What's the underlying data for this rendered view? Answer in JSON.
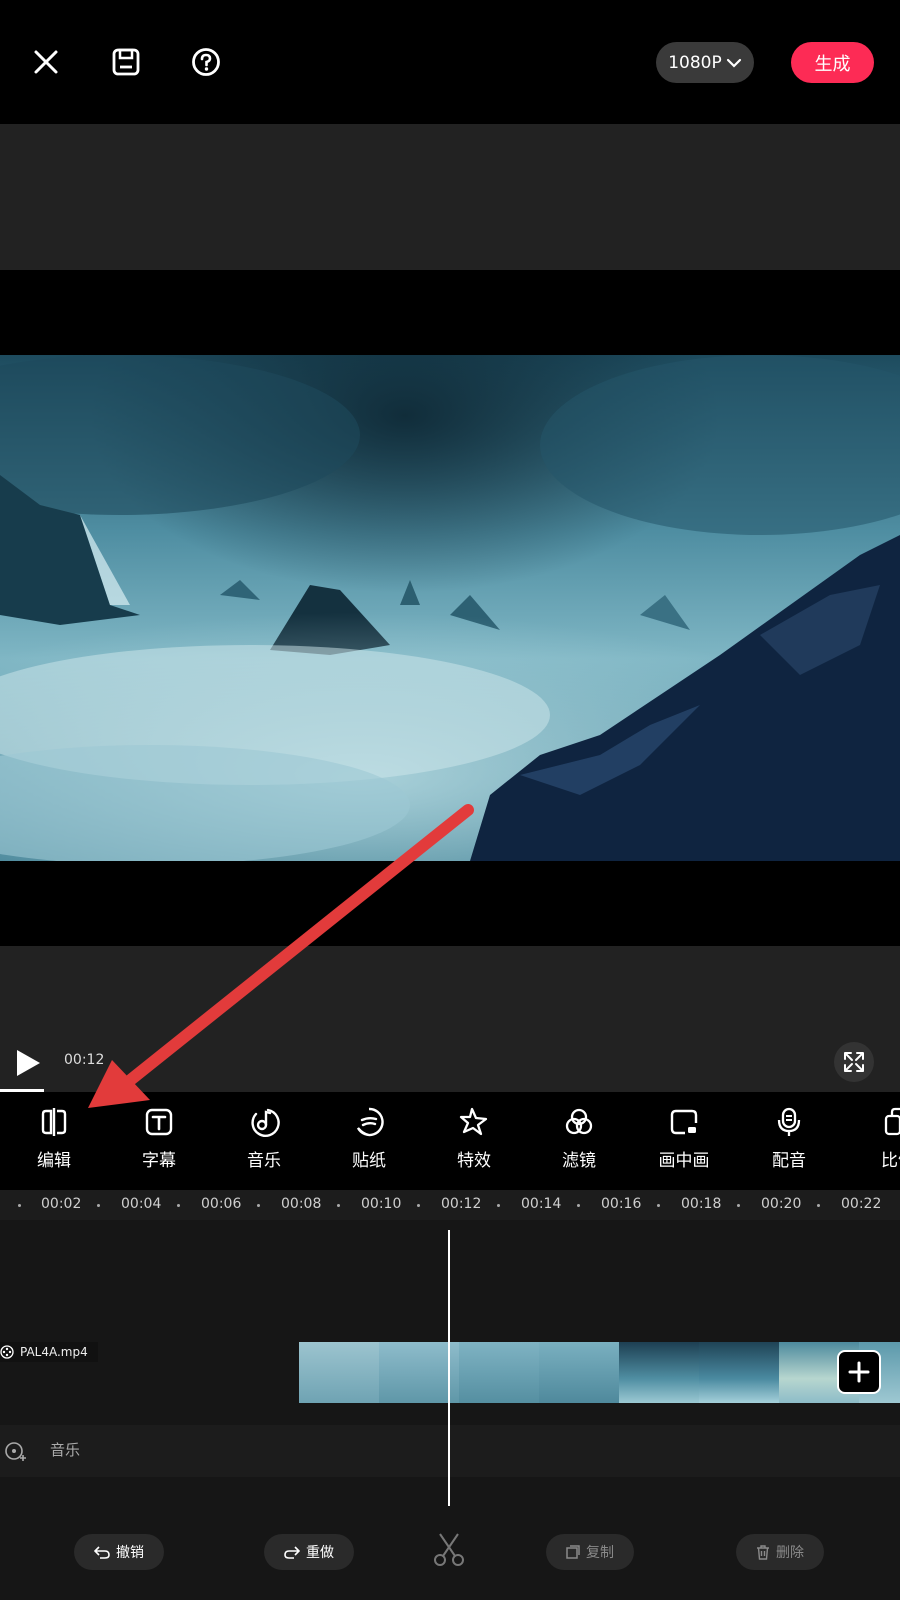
{
  "topbar": {
    "close_icon": "close-icon",
    "save_icon": "save-icon",
    "help_icon": "help-icon",
    "resolution": "1080P",
    "generate": "生成"
  },
  "player": {
    "time": "00:12"
  },
  "toolbar": {
    "items": [
      {
        "label": "编辑",
        "icon": "split-edit-icon"
      },
      {
        "label": "字幕",
        "icon": "text-icon"
      },
      {
        "label": "音乐",
        "icon": "music-note-icon"
      },
      {
        "label": "贴纸",
        "icon": "sticker-icon"
      },
      {
        "label": "特效",
        "icon": "star-effect-icon"
      },
      {
        "label": "滤镜",
        "icon": "filter-icon"
      },
      {
        "label": "画中画",
        "icon": "picture-in-picture-icon"
      },
      {
        "label": "配音",
        "icon": "microphone-icon"
      },
      {
        "label": "比例",
        "icon": "ratio-icon"
      }
    ]
  },
  "ruler": {
    "ticks": [
      "00:02",
      "00:04",
      "00:06",
      "00:08",
      "00:10",
      "00:12",
      "00:14",
      "00:16",
      "00:18",
      "00:20",
      "00:22"
    ]
  },
  "timeline": {
    "clip_name": "PAL4A.mp4",
    "music_track": "音乐"
  },
  "bottombar": {
    "undo": "撤销",
    "redo": "重做",
    "copy": "复制",
    "delete": "删除"
  },
  "colors": {
    "accent": "#fd2b55",
    "annotation_arrow": "#e23b3b"
  }
}
